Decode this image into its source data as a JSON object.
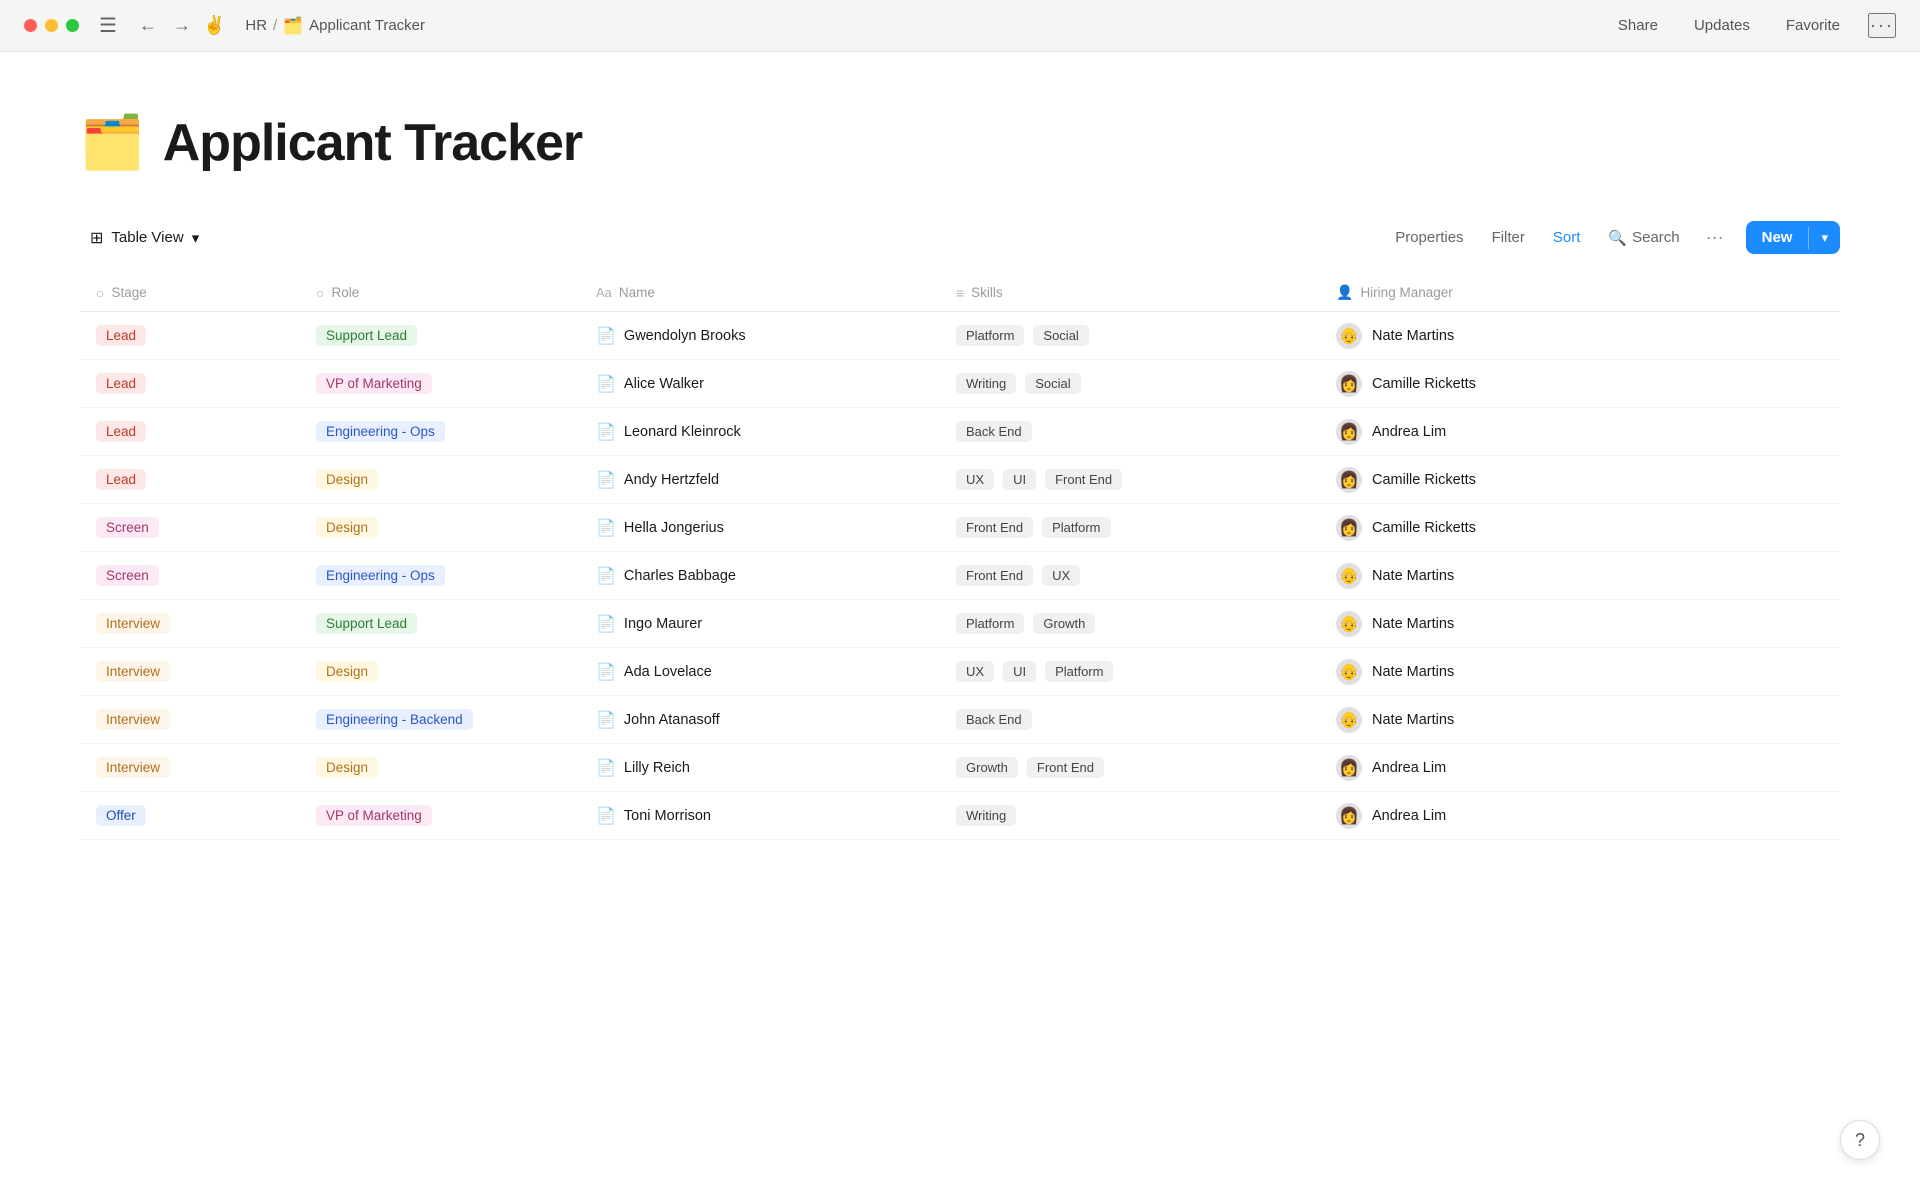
{
  "titlebar": {
    "breadcrumb_workspace": "HR",
    "breadcrumb_separator": "/",
    "breadcrumb_page": "Applicant Tracker",
    "app_emoji": "🗂️",
    "actions": {
      "share": "Share",
      "updates": "Updates",
      "favorite": "Favorite",
      "more": "···"
    }
  },
  "page": {
    "emoji": "🗂️",
    "title": "Applicant Tracker"
  },
  "toolbar": {
    "view_icon": "⊞",
    "view_label": "Table View",
    "view_chevron": "▾",
    "properties": "Properties",
    "filter": "Filter",
    "sort": "Sort",
    "search": "Search",
    "more": "···",
    "new_label": "New",
    "new_arrow": "▾"
  },
  "columns": [
    {
      "icon": "○",
      "label": "Stage"
    },
    {
      "icon": "○",
      "label": "Role"
    },
    {
      "icon": "Aa",
      "label": "Name"
    },
    {
      "icon": "≡",
      "label": "Skills"
    },
    {
      "icon": "👤",
      "label": "Hiring Manager"
    }
  ],
  "rows": [
    {
      "stage": "Lead",
      "stage_type": "lead",
      "role": "Support Lead",
      "role_type": "support",
      "name": "Gwendolyn Brooks",
      "skills": [
        "Platform",
        "Social"
      ],
      "manager": "Nate Martins",
      "manager_emoji": "👴"
    },
    {
      "stage": "Lead",
      "stage_type": "lead",
      "role": "VP of Marketing",
      "role_type": "vp-marketing",
      "name": "Alice Walker",
      "skills": [
        "Writing",
        "Social"
      ],
      "manager": "Camille Ricketts",
      "manager_emoji": "👩"
    },
    {
      "stage": "Lead",
      "stage_type": "lead",
      "role": "Engineering - Ops",
      "role_type": "eng-ops",
      "name": "Leonard Kleinrock",
      "skills": [
        "Back End"
      ],
      "manager": "Andrea Lim",
      "manager_emoji": "👩"
    },
    {
      "stage": "Lead",
      "stage_type": "lead",
      "role": "Design",
      "role_type": "design",
      "name": "Andy Hertzfeld",
      "skills": [
        "UX",
        "UI",
        "Front End"
      ],
      "manager": "Camille Ricketts",
      "manager_emoji": "👩"
    },
    {
      "stage": "Screen",
      "stage_type": "screen",
      "role": "Design",
      "role_type": "design",
      "name": "Hella Jongerius",
      "skills": [
        "Front End",
        "Platform"
      ],
      "manager": "Camille Ricketts",
      "manager_emoji": "👩"
    },
    {
      "stage": "Screen",
      "stage_type": "screen",
      "role": "Engineering - Ops",
      "role_type": "eng-ops",
      "name": "Charles Babbage",
      "skills": [
        "Front End",
        "UX"
      ],
      "manager": "Nate Martins",
      "manager_emoji": "👴"
    },
    {
      "stage": "Interview",
      "stage_type": "interview",
      "role": "Support Lead",
      "role_type": "support",
      "name": "Ingo Maurer",
      "skills": [
        "Platform",
        "Growth"
      ],
      "manager": "Nate Martins",
      "manager_emoji": "👴"
    },
    {
      "stage": "Interview",
      "stage_type": "interview",
      "role": "Design",
      "role_type": "design",
      "name": "Ada Lovelace",
      "skills": [
        "UX",
        "UI",
        "Platform"
      ],
      "manager": "Nate Martins",
      "manager_emoji": "👴"
    },
    {
      "stage": "Interview",
      "stage_type": "interview",
      "role": "Engineering - Backend",
      "role_type": "eng-backend",
      "name": "John Atanasoff",
      "skills": [
        "Back End"
      ],
      "manager": "Nate Martins",
      "manager_emoji": "👴"
    },
    {
      "stage": "Interview",
      "stage_type": "interview",
      "role": "Design",
      "role_type": "design",
      "name": "Lilly Reich",
      "skills": [
        "Growth",
        "Front End"
      ],
      "manager": "Andrea Lim",
      "manager_emoji": "👩"
    },
    {
      "stage": "Offer",
      "stage_type": "offer",
      "role": "VP of Marketing",
      "role_type": "vp-marketing",
      "name": "Toni Morrison",
      "skills": [
        "Writing"
      ],
      "manager": "Andrea Lim",
      "manager_emoji": "👩"
    }
  ],
  "help": "?"
}
